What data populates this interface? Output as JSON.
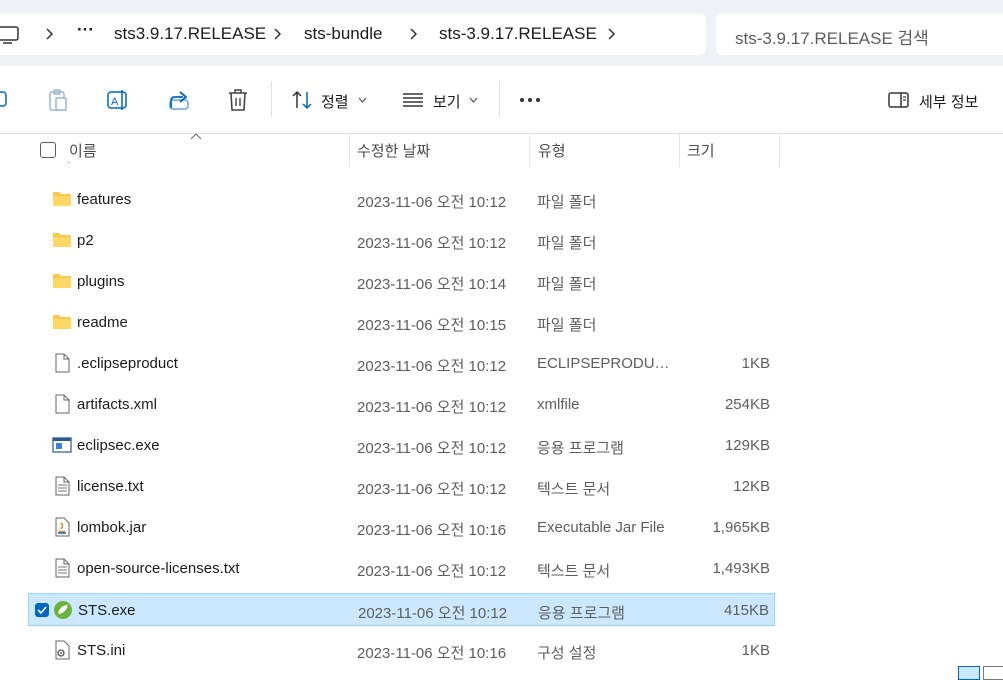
{
  "address_bar": {
    "breadcrumbs": [
      "sts3.9.17.RELEASE",
      "sts-bundle",
      "sts-3.9.17.RELEASE"
    ],
    "search_placeholder": "sts-3.9.17.RELEASE 검색"
  },
  "toolbar": {
    "sort_label": "정렬",
    "view_label": "보기",
    "details_label": "세부 정보"
  },
  "columns": {
    "name": "이름",
    "date": "수정한 날짜",
    "type": "유형",
    "size": "크기"
  },
  "files": [
    {
      "name": "features",
      "date": "2023-11-06 오전 10:12",
      "type": "파일 폴더",
      "size": "",
      "icon": "folder-icon"
    },
    {
      "name": "p2",
      "date": "2023-11-06 오전 10:12",
      "type": "파일 폴더",
      "size": "",
      "icon": "folder-icon"
    },
    {
      "name": "plugins",
      "date": "2023-11-06 오전 10:14",
      "type": "파일 폴더",
      "size": "",
      "icon": "folder-icon"
    },
    {
      "name": "readme",
      "date": "2023-11-06 오전 10:15",
      "type": "파일 폴더",
      "size": "",
      "icon": "folder-icon"
    },
    {
      "name": ".eclipseproduct",
      "date": "2023-11-06 오전 10:12",
      "type": "ECLIPSEPRODUCT...",
      "size": "1KB",
      "icon": "blank-file-icon"
    },
    {
      "name": "artifacts.xml",
      "date": "2023-11-06 오전 10:12",
      "type": "xmlfile",
      "size": "254KB",
      "icon": "blank-file-icon"
    },
    {
      "name": "eclipsec.exe",
      "date": "2023-11-06 오전 10:12",
      "type": "응용 프로그램",
      "size": "129KB",
      "icon": "exe-file-icon"
    },
    {
      "name": "license.txt",
      "date": "2023-11-06 오전 10:12",
      "type": "텍스트 문서",
      "size": "12KB",
      "icon": "text-file-icon"
    },
    {
      "name": "lombok.jar",
      "date": "2023-11-06 오전 10:16",
      "type": "Executable Jar File",
      "size": "1,965KB",
      "icon": "java-jar-icon"
    },
    {
      "name": "open-source-licenses.txt",
      "date": "2023-11-06 오전 10:12",
      "type": "텍스트 문서",
      "size": "1,493KB",
      "icon": "text-file-icon"
    },
    {
      "name": "STS.exe",
      "date": "2023-11-06 오전 10:12",
      "type": "응용 프로그램",
      "size": "415KB",
      "icon": "spring-icon",
      "selected": true
    },
    {
      "name": "STS.ini",
      "date": "2023-11-06 오전 10:16",
      "type": "구성 설정",
      "size": "1KB",
      "icon": "settings-file-icon"
    }
  ],
  "colors": {
    "selection_bg": "#cce8ff",
    "selection_border": "#99d1ff",
    "accent": "#0067c0",
    "folder": "#f8c84c"
  }
}
